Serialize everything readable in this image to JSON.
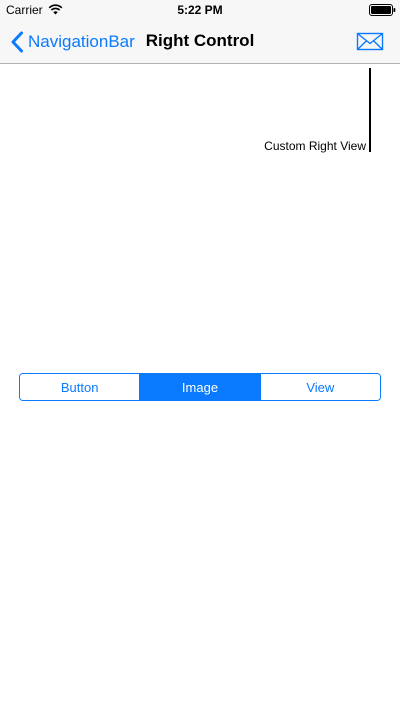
{
  "status_bar": {
    "carrier": "Carrier",
    "time": "5:22 PM",
    "wifi_icon": "wifi-icon",
    "battery_icon": "battery-icon"
  },
  "nav_bar": {
    "back_label": "NavigationBar",
    "title": "Right Control",
    "right_icon": "mail-icon",
    "accent_color": "#0a7aff"
  },
  "annotation": {
    "label": "Custom Right View"
  },
  "segmented_control": {
    "segments": [
      {
        "label": "Button",
        "selected": false
      },
      {
        "label": "Image",
        "selected": true
      },
      {
        "label": "View",
        "selected": false
      }
    ]
  }
}
